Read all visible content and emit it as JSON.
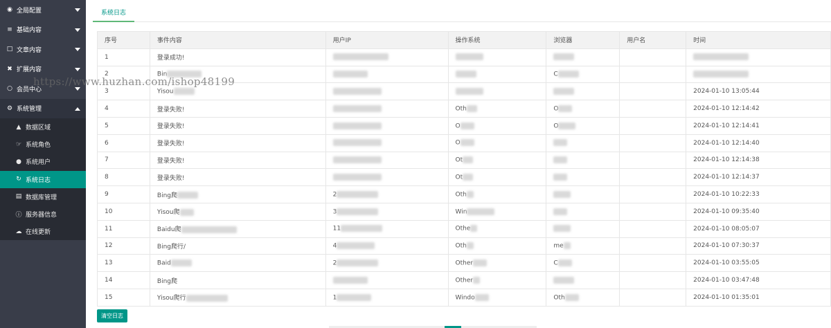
{
  "sidebar": {
    "items": [
      {
        "label": "全局配置",
        "icon": "globe-icon"
      },
      {
        "label": "基础内容",
        "icon": "sliders-icon"
      },
      {
        "label": "文章内容",
        "icon": "file-icon"
      },
      {
        "label": "扩展内容",
        "icon": "puzzle-icon"
      },
      {
        "label": "会员中心",
        "icon": "user-icon"
      },
      {
        "label": "系统管理",
        "icon": "gear-icon"
      }
    ],
    "sub_items": [
      {
        "label": "数据区域",
        "icon": "sitemap-icon"
      },
      {
        "label": "系统角色",
        "icon": "hand-icon"
      },
      {
        "label": "系统用户",
        "icon": "users-icon"
      },
      {
        "label": "系统日志",
        "icon": "history-icon"
      },
      {
        "label": "数据库管理",
        "icon": "database-icon"
      },
      {
        "label": "服务器信息",
        "icon": "info-icon"
      },
      {
        "label": "在线更新",
        "icon": "cloud-icon"
      }
    ]
  },
  "tabs": {
    "active": "系统日志"
  },
  "table": {
    "headers": [
      "序号",
      "事件内容",
      "用户IP",
      "操作系统",
      "浏览器",
      "用户名",
      "时间"
    ],
    "rows": [
      {
        "id": "1",
        "event": "登录成功!",
        "ip": "",
        "os": "",
        "browser": "",
        "user": "",
        "time": ""
      },
      {
        "id": "2",
        "event": "Bin",
        "ip": "",
        "os": "",
        "browser": "C",
        "user": "",
        "time": ""
      },
      {
        "id": "3",
        "event": "Yisou",
        "ip": "",
        "os": "",
        "browser": "",
        "user": "",
        "time": "2024-01-10 13:05:44"
      },
      {
        "id": "4",
        "event": "登录失败!",
        "ip": "",
        "os": "Oth",
        "browser": "O",
        "user": "",
        "time": "2024-01-10 12:14:42"
      },
      {
        "id": "5",
        "event": "登录失败!",
        "ip": "",
        "os": "O",
        "browser": "O",
        "user": "",
        "time": "2024-01-10 12:14:41"
      },
      {
        "id": "6",
        "event": "登录失败!",
        "ip": "",
        "os": "O",
        "browser": "",
        "user": "",
        "time": "2024-01-10 12:14:40"
      },
      {
        "id": "7",
        "event": "登录失败!",
        "ip": "",
        "os": "Ot",
        "browser": "",
        "user": "",
        "time": "2024-01-10 12:14:38"
      },
      {
        "id": "8",
        "event": "登录失败!",
        "ip": "",
        "os": "Ot",
        "browser": "",
        "user": "",
        "time": "2024-01-10 12:14:37"
      },
      {
        "id": "9",
        "event": "Bing爬",
        "ip": "2",
        "os": "Oth",
        "browser": "",
        "user": "",
        "time": "2024-01-10 10:22:33"
      },
      {
        "id": "10",
        "event": "Yisou爬",
        "ip": "3",
        "os": "Win",
        "browser": "",
        "user": "",
        "time": "2024-01-10 09:35:40"
      },
      {
        "id": "11",
        "event": "Baidu爬",
        "ip": "11",
        "os": "Othe",
        "browser": "",
        "user": "",
        "time": "2024-01-10 08:05:07"
      },
      {
        "id": "12",
        "event": "Bing爬行/",
        "ip": "4",
        "os": "Oth",
        "browser": "me",
        "user": "",
        "time": "2024-01-10 07:30:37"
      },
      {
        "id": "13",
        "event": "Baid",
        "ip": "2",
        "os": "Other",
        "browser": "C",
        "user": "",
        "time": "2024-01-10 03:55:05"
      },
      {
        "id": "14",
        "event": "Bing爬",
        "ip": "",
        "os": "Other",
        "browser": "",
        "user": "",
        "time": "2024-01-10 03:47:48"
      },
      {
        "id": "15",
        "event": "Yisou爬行",
        "ip": "1",
        "os": "Windo",
        "browser": "Oth",
        "user": "",
        "time": "2024-01-10 01:35:01"
      }
    ]
  },
  "actions": {
    "clear_label": "清空日志"
  },
  "watermark": "https://www.huzhan.com/ishop48199",
  "colors": {
    "sidebar_bg": "#393d49",
    "accent": "#009688",
    "tab_underline": "#5fb878"
  }
}
